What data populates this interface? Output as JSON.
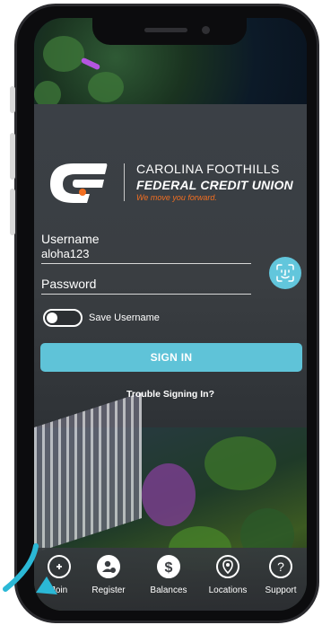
{
  "brand": {
    "line1": "CAROLINA FOOTHILLS",
    "line2": "FEDERAL CREDIT UNION",
    "tagline": "We move you forward.",
    "accent_color": "#f26f21"
  },
  "login": {
    "username_label": "Username",
    "username_value": "aloha123",
    "password_label": "Password",
    "password_value": "",
    "faceid_icon": "face-id-icon",
    "save_username_label": "Save Username",
    "save_username_on": false,
    "sign_in_label": "SIGN IN",
    "trouble_label": "Trouble Signing In?",
    "button_color": "#5fc3d8"
  },
  "tabs": [
    {
      "label": "Join",
      "icon": "join-icon"
    },
    {
      "label": "Register",
      "icon": "register-icon"
    },
    {
      "label": "Balances",
      "icon": "dollar-icon"
    },
    {
      "label": "Locations",
      "icon": "location-pin-icon"
    },
    {
      "label": "Support",
      "icon": "question-icon"
    }
  ],
  "annotation": {
    "arrow_color": "#2bb8d6"
  }
}
